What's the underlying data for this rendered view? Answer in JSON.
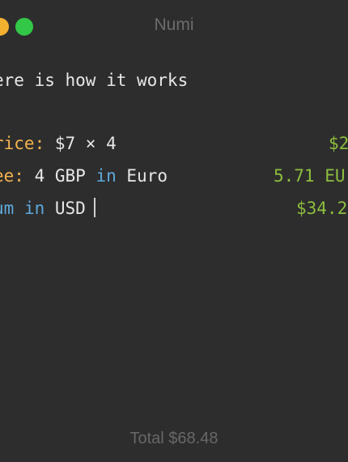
{
  "window": {
    "title": "Numi",
    "accent_colors": {
      "minimize": "#f1b02f",
      "maximize": "#33c748",
      "label_orange": "#f3b34f",
      "keyword_blue": "#5fa9dc",
      "result_green": "#8dbe3e"
    }
  },
  "editor": {
    "intro": "ere is how it works",
    "lines": [
      {
        "label": "rice:",
        "expression": " $7 × 4",
        "result": "$2"
      },
      {
        "label": "ee:",
        "expression_prefix": " 4 GBP ",
        "keyword": "in",
        "expression_suffix": " Euro",
        "result": "5.71 EU"
      },
      {
        "label": "um",
        "keyword": "in",
        "expression_suffix": " USD",
        "result": "$34.2"
      }
    ]
  },
  "footer": {
    "total": "Total $68.48"
  }
}
